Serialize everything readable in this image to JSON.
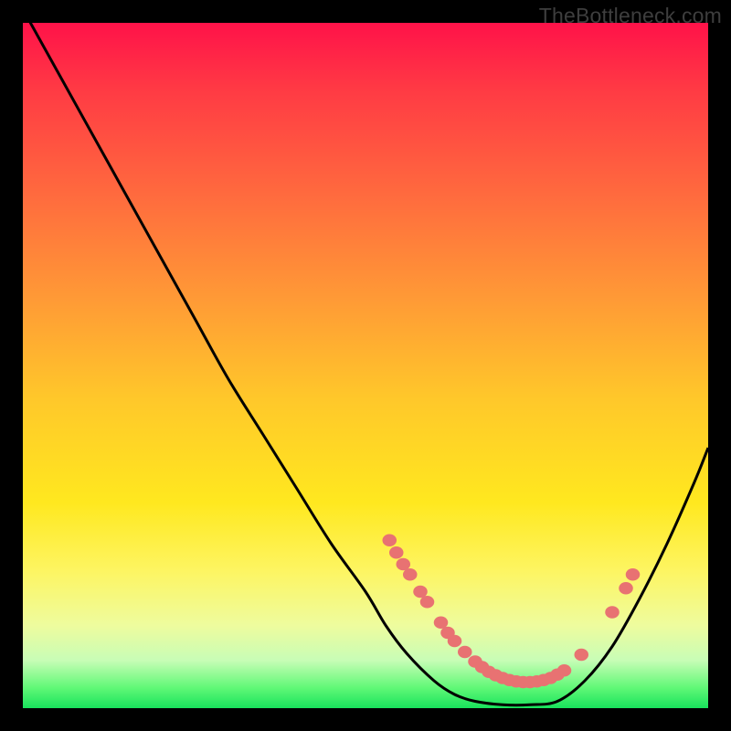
{
  "watermark": "TheBottleneck.com",
  "colors": {
    "background": "#000000",
    "gradient_top": "#ff1249",
    "gradient_mid": "#ffe81f",
    "gradient_bottom": "#18e35c",
    "curve": "#000000",
    "dot": "#e87272"
  },
  "chart_data": {
    "type": "line",
    "title": "",
    "xlabel": "",
    "ylabel": "",
    "xlim": [
      0,
      100
    ],
    "ylim": [
      0,
      100
    ],
    "series": [
      {
        "name": "bottleneck-curve",
        "x_pct": [
          0,
          5,
          10,
          15,
          20,
          25,
          30,
          35,
          40,
          45,
          50,
          53,
          56,
          60,
          63,
          66,
          70,
          74,
          78,
          82,
          86,
          90,
          94,
          98,
          100
        ],
        "y_pct": [
          102,
          93,
          84,
          75,
          66,
          57,
          48,
          40,
          32,
          24,
          17,
          12,
          8,
          4,
          2,
          1,
          0.5,
          0.5,
          1,
          4,
          9,
          16,
          24,
          33,
          38
        ],
        "note": "y_pct is distance from bottom in percent of plot height; curve descends from top-left, flattens near bottom ~60-78%, then rises to right edge"
      }
    ],
    "dots": [
      {
        "x_pct": 53.5,
        "y_pct": 24.5
      },
      {
        "x_pct": 54.5,
        "y_pct": 22.7
      },
      {
        "x_pct": 55.5,
        "y_pct": 21.0
      },
      {
        "x_pct": 56.5,
        "y_pct": 19.5
      },
      {
        "x_pct": 58.0,
        "y_pct": 17.0
      },
      {
        "x_pct": 59.0,
        "y_pct": 15.5
      },
      {
        "x_pct": 61.0,
        "y_pct": 12.5
      },
      {
        "x_pct": 62.0,
        "y_pct": 11.0
      },
      {
        "x_pct": 63.0,
        "y_pct": 9.8
      },
      {
        "x_pct": 64.5,
        "y_pct": 8.2
      },
      {
        "x_pct": 66.0,
        "y_pct": 6.8
      },
      {
        "x_pct": 67.0,
        "y_pct": 6.0
      },
      {
        "x_pct": 68.0,
        "y_pct": 5.3
      },
      {
        "x_pct": 69.0,
        "y_pct": 4.8
      },
      {
        "x_pct": 70.0,
        "y_pct": 4.4
      },
      {
        "x_pct": 71.0,
        "y_pct": 4.1
      },
      {
        "x_pct": 72.0,
        "y_pct": 3.9
      },
      {
        "x_pct": 73.0,
        "y_pct": 3.8
      },
      {
        "x_pct": 74.0,
        "y_pct": 3.8
      },
      {
        "x_pct": 75.0,
        "y_pct": 3.9
      },
      {
        "x_pct": 76.0,
        "y_pct": 4.1
      },
      {
        "x_pct": 77.0,
        "y_pct": 4.4
      },
      {
        "x_pct": 78.0,
        "y_pct": 4.9
      },
      {
        "x_pct": 79.0,
        "y_pct": 5.5
      },
      {
        "x_pct": 81.5,
        "y_pct": 7.8
      },
      {
        "x_pct": 86.0,
        "y_pct": 14.0
      },
      {
        "x_pct": 88.0,
        "y_pct": 17.5
      },
      {
        "x_pct": 89.0,
        "y_pct": 19.5
      }
    ],
    "dot_radius_pct": 0.9
  }
}
